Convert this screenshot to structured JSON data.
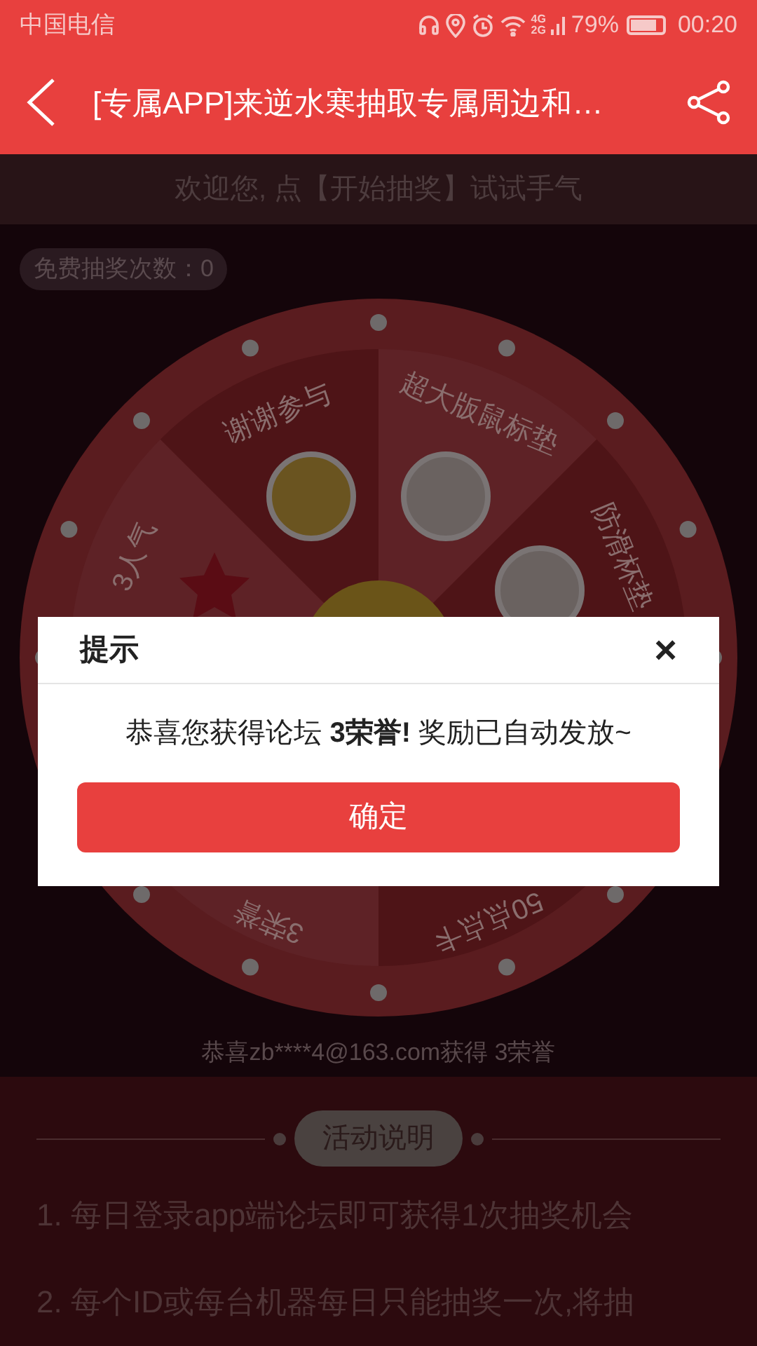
{
  "status_bar": {
    "carrier": "中国电信",
    "network": "4G",
    "network2": "2G",
    "battery": "79%",
    "time": "00:20"
  },
  "header": {
    "title": "[专属APP]来逆水寒抽取专属周边和…"
  },
  "welcome": "欢迎您, 点【开始抽奖】试试手气",
  "free_count": "免费抽奖次数：0",
  "wheel": {
    "segments": [
      {
        "label": "超大版鼠标垫",
        "kind": "photo"
      },
      {
        "label": "防滑杯垫",
        "kind": "photo"
      },
      {
        "label": "50点点卡",
        "kind": "none"
      },
      {
        "label": "3荣誉",
        "kind": "none"
      },
      {
        "label": "3人气",
        "kind": "star"
      },
      {
        "label": "谢谢参与",
        "kind": "emoji"
      }
    ]
  },
  "winner": "恭喜zb****4@163.com获得 3荣誉",
  "rules": {
    "heading": "活动说明",
    "items": [
      "1. 每日登录app端论坛即可获得1次抽奖机会",
      "2. 每个ID或每台机器每日只能抽奖一次,将抽"
    ]
  },
  "dialog": {
    "title": "提示",
    "close": "×",
    "message": "恭喜您获得论坛 **3荣誉!** 奖励已自动发放~",
    "button": "确定"
  }
}
